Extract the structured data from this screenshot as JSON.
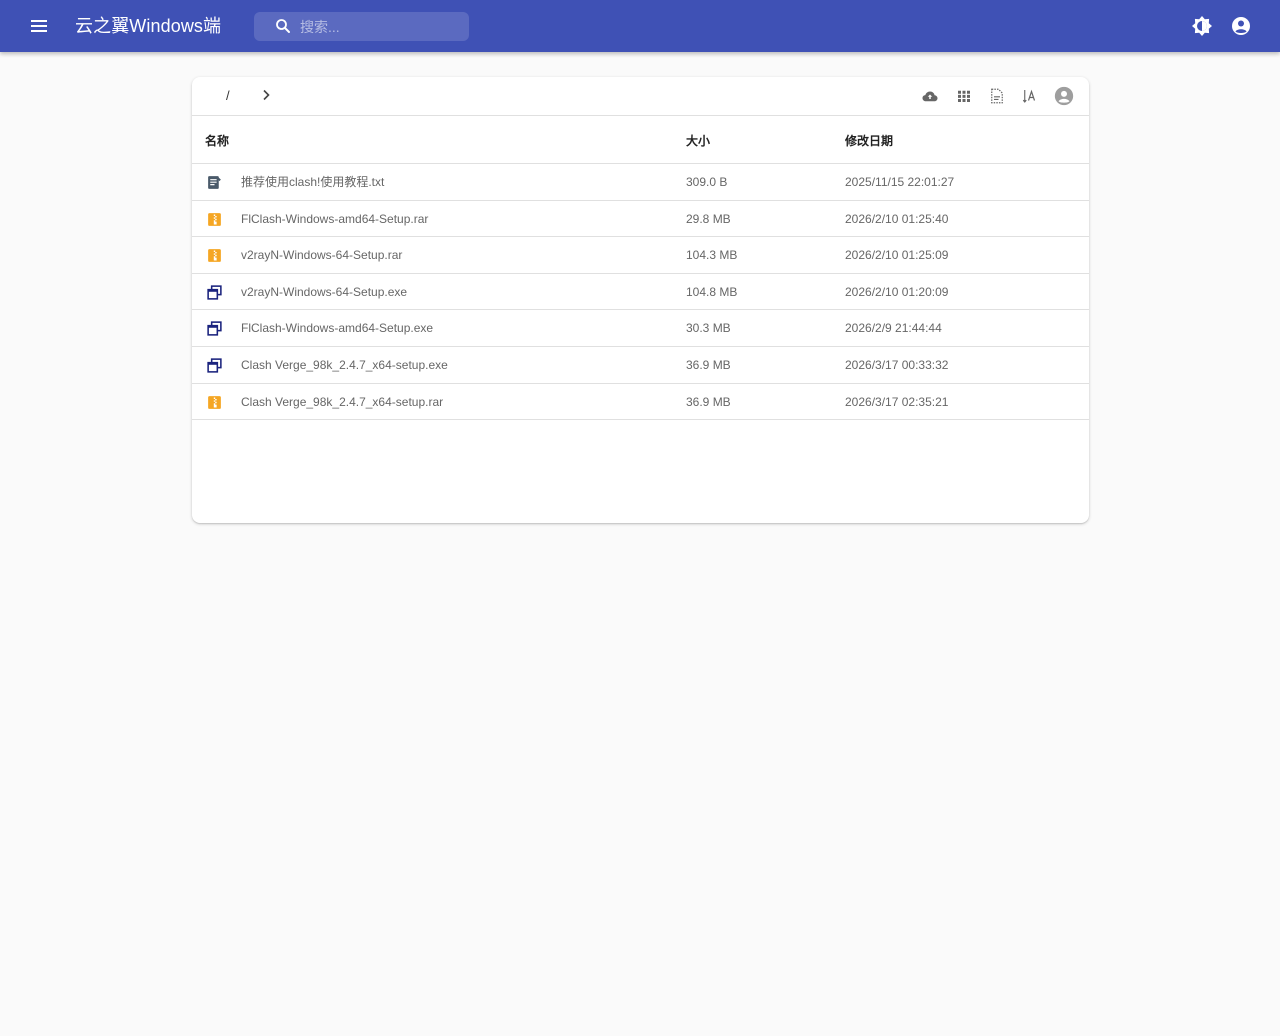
{
  "app": {
    "title": "云之翼Windows端",
    "brand_color": "#3f51b5"
  },
  "search": {
    "placeholder": "搜索..."
  },
  "breadcrumb": {
    "root": "/"
  },
  "toolbar_icons": [
    "upload-cloud-icon",
    "grid-view-icon",
    "sort-icon",
    "sort-alpha-icon",
    "user-avatar-icon"
  ],
  "table": {
    "columns": [
      "名称",
      "大小",
      "修改日期"
    ],
    "rows": [
      {
        "type": "text",
        "name": "推荐使用clash!使用教程.txt",
        "size": "309.0 B",
        "date": "2025/11/15 22:01:27"
      },
      {
        "type": "archive",
        "name": "FlClash-Windows-amd64-Setup.rar",
        "size": "29.8 MB",
        "date": "2026/2/10 01:25:40"
      },
      {
        "type": "archive",
        "name": "v2rayN-Windows-64-Setup.rar",
        "size": "104.3 MB",
        "date": "2026/2/10 01:25:09"
      },
      {
        "type": "exe",
        "name": "v2rayN-Windows-64-Setup.exe",
        "size": "104.8 MB",
        "date": "2026/2/10 01:20:09"
      },
      {
        "type": "exe",
        "name": "FlClash-Windows-amd64-Setup.exe",
        "size": "30.3 MB",
        "date": "2026/2/9 21:44:44"
      },
      {
        "type": "exe",
        "name": "Clash Verge_98k_2.4.7_x64-setup.exe",
        "size": "36.9 MB",
        "date": "2026/3/17 00:33:32"
      },
      {
        "type": "archive",
        "name": "Clash Verge_98k_2.4.7_x64-setup.rar",
        "size": "36.9 MB",
        "date": "2026/3/17 02:35:21"
      }
    ]
  }
}
